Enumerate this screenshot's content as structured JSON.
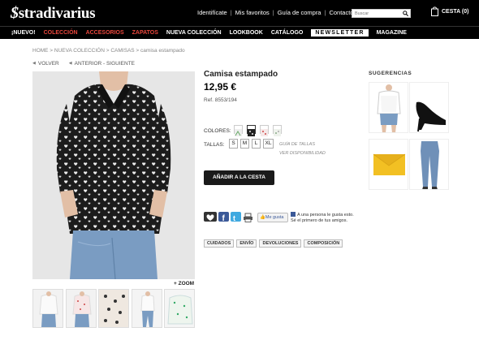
{
  "header": {
    "logo": "stradivarius",
    "links": [
      "Identifícate",
      "Mis favoritos",
      "Guía de compra",
      "Contacto"
    ],
    "search_placeholder": "Buscar",
    "cart_label": "CESTA (0)"
  },
  "nav": {
    "items": [
      {
        "label": "¡NUEVO!",
        "color": "#ffffff"
      },
      {
        "label": "COLECCIÓN",
        "color": "#e8463c"
      },
      {
        "label": "ACCESORIOS",
        "color": "#e8463c"
      },
      {
        "label": "ZAPATOS",
        "color": "#e8463c"
      },
      {
        "label": "NUEVA COLECCIÓN",
        "color": "#ffffff"
      },
      {
        "label": "LOOKBOOK",
        "color": "#ffffff"
      },
      {
        "label": "CATÁLOGO",
        "color": "#ffffff"
      },
      {
        "label": "NEWSLETTER",
        "color": "#000000"
      },
      {
        "label": "MAGAZINE",
        "color": "#ffffff"
      }
    ]
  },
  "breadcrumb": {
    "items": [
      "HOME",
      "NUEVA COLECCIÓN",
      "CAMISAS",
      "camisa estampado"
    ],
    "back": "VOLVER",
    "prev_next": "ANTERIOR - SIGUIENTE"
  },
  "gallery": {
    "zoom": "+ ZOOM"
  },
  "product": {
    "title": "Camisa estampado",
    "price": "12,95 €",
    "ref": "Ref. 8553/194",
    "colors_label": "COLORES:",
    "sizes_label": "TALLAS:",
    "sizes": [
      "S",
      "M",
      "L",
      "XL"
    ],
    "size_guide": "GUÍA DE TALLAS",
    "availability": "VER DISPONIBILIDAD",
    "add_to_cart": "AÑADIR A LA CESTA"
  },
  "social": {
    "like_button": "Me gusta",
    "like_text": "A una persona le gusta esto. Sé el primero de tus amigos."
  },
  "tabs": [
    "CUIDADOS",
    "ENVÍO",
    "DEVOLUCIONES",
    "COMPOSICIÓN"
  ],
  "suggestions": {
    "title": "SUGERENCIAS"
  }
}
